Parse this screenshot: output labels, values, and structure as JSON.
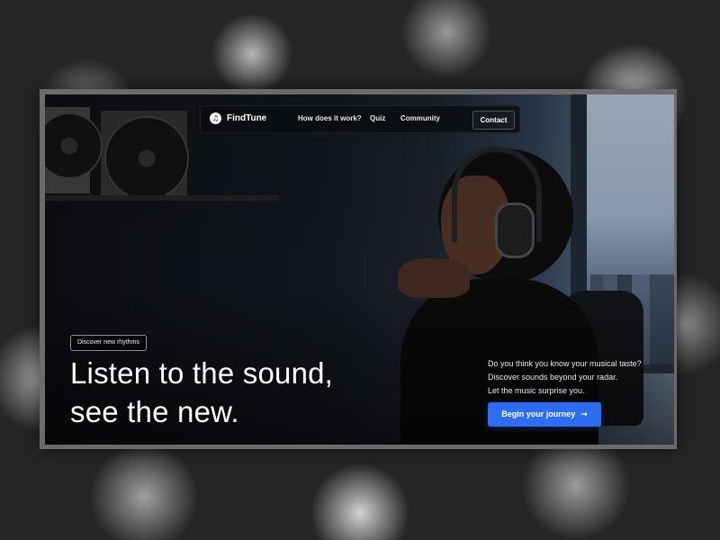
{
  "brand": {
    "name": "FindTune",
    "icon": "music-note-icon"
  },
  "nav": {
    "links": [
      {
        "label": "How does it work?"
      },
      {
        "label": "Quiz"
      },
      {
        "label": "Community"
      }
    ],
    "contact_label": "Contact"
  },
  "hero": {
    "tag": "Discover new rhythms",
    "headline_line1": "Listen to the sound,",
    "headline_line2": "see the new.",
    "side_lines": [
      "Do you think you know your musical taste?",
      "Discover sounds beyond your radar.",
      "Let the music surprise you."
    ],
    "cta_label": "Begin your journey",
    "cta_icon": "arrow-right-icon"
  },
  "colors": {
    "accent": "#2f6df0",
    "background": "#0b0d12"
  }
}
